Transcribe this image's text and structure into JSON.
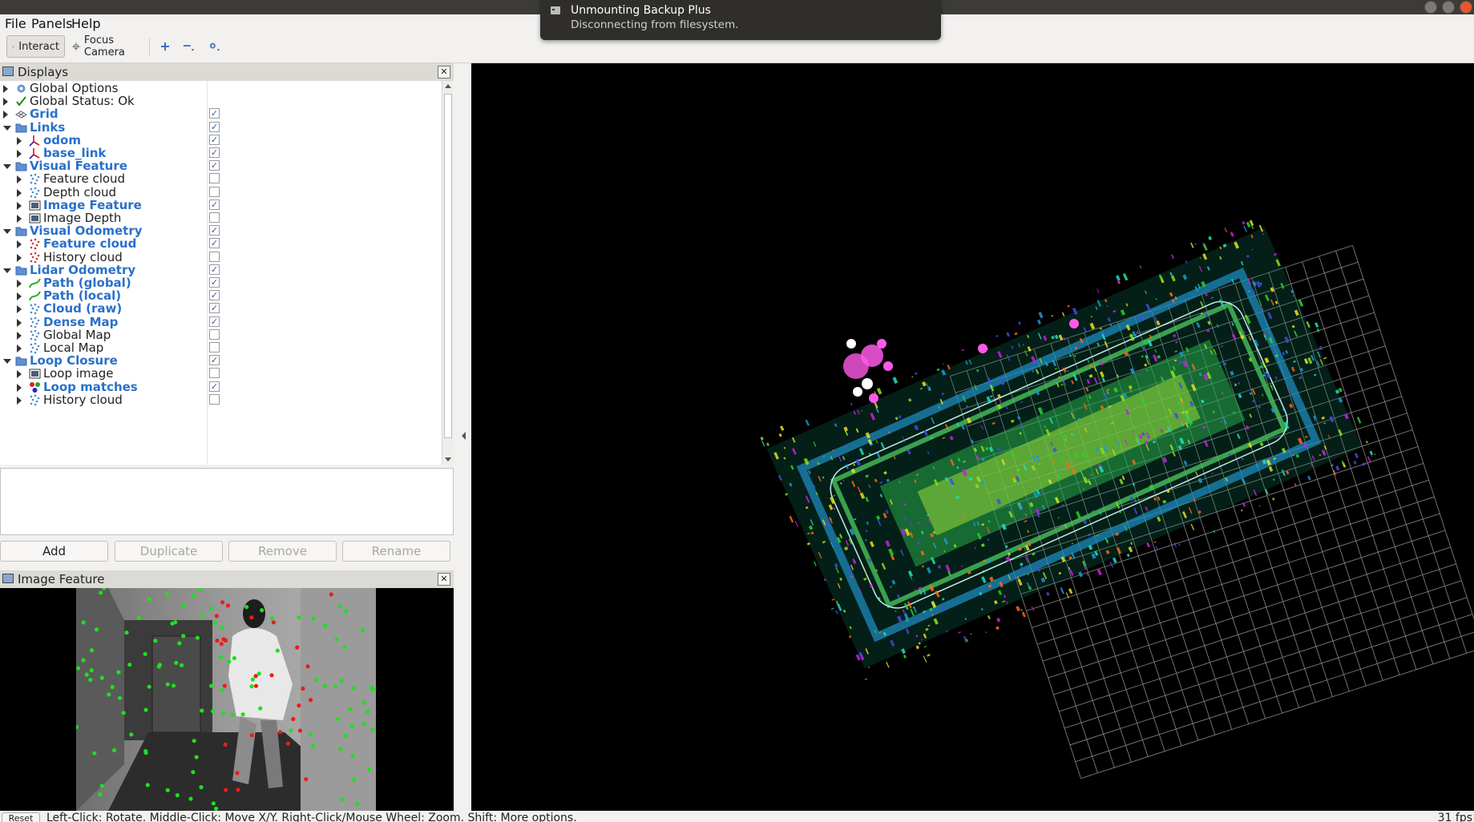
{
  "menu": {
    "file": "File",
    "panels": "Panels",
    "help": "Help"
  },
  "toolbar": {
    "interact": "Interact",
    "focus_camera": "Focus Camera"
  },
  "notification": {
    "title": "Unmounting Backup Plus",
    "message": "Disconnecting from filesystem."
  },
  "displays_panel": {
    "title": "Displays",
    "rows": [
      {
        "label": "Global Options",
        "indent": 0,
        "expand": "right",
        "icon": "gear-icon",
        "bold": false,
        "check": null
      },
      {
        "label": "Global Status: Ok",
        "indent": 0,
        "expand": "right",
        "icon": "checkmark-icon",
        "bold": false,
        "check": null
      },
      {
        "label": "Grid",
        "indent": 0,
        "expand": "right",
        "icon": "grid-icon",
        "bold": true,
        "check": true
      },
      {
        "label": "Links",
        "indent": 0,
        "expand": "down",
        "icon": "folder-icon",
        "bold": true,
        "check": true
      },
      {
        "label": "odom",
        "indent": 1,
        "expand": "right",
        "icon": "axes-icon",
        "bold": true,
        "check": true
      },
      {
        "label": "base_link",
        "indent": 1,
        "expand": "right",
        "icon": "axes-icon",
        "bold": true,
        "check": true
      },
      {
        "label": "Visual Feature",
        "indent": 0,
        "expand": "down",
        "icon": "folder-icon",
        "bold": true,
        "check": true
      },
      {
        "label": "Feature cloud",
        "indent": 1,
        "expand": "right",
        "icon": "pointcloud-icon",
        "bold": false,
        "check": false
      },
      {
        "label": "Depth cloud",
        "indent": 1,
        "expand": "right",
        "icon": "pointcloud-icon",
        "bold": false,
        "check": false
      },
      {
        "label": "Image Feature",
        "indent": 1,
        "expand": "right",
        "icon": "image-icon",
        "bold": true,
        "check": true
      },
      {
        "label": "Image Depth",
        "indent": 1,
        "expand": "right",
        "icon": "image-icon",
        "bold": false,
        "check": false
      },
      {
        "label": "Visual Odometry",
        "indent": 0,
        "expand": "down",
        "icon": "folder-icon",
        "bold": true,
        "check": true
      },
      {
        "label": "Feature cloud",
        "indent": 1,
        "expand": "right",
        "icon": "pointcloud-red-icon",
        "bold": true,
        "check": true
      },
      {
        "label": "History cloud",
        "indent": 1,
        "expand": "right",
        "icon": "pointcloud-red-icon",
        "bold": false,
        "check": false
      },
      {
        "label": "Lidar Odometry",
        "indent": 0,
        "expand": "down",
        "icon": "folder-icon",
        "bold": true,
        "check": true
      },
      {
        "label": "Path (global)",
        "indent": 1,
        "expand": "right",
        "icon": "path-icon",
        "bold": true,
        "check": true
      },
      {
        "label": "Path (local)",
        "indent": 1,
        "expand": "right",
        "icon": "path-icon",
        "bold": true,
        "check": true
      },
      {
        "label": "Cloud (raw)",
        "indent": 1,
        "expand": "right",
        "icon": "pointcloud-icon",
        "bold": true,
        "check": true
      },
      {
        "label": "Dense Map",
        "indent": 1,
        "expand": "right",
        "icon": "pointcloud-icon",
        "bold": true,
        "check": true
      },
      {
        "label": "Global Map",
        "indent": 1,
        "expand": "right",
        "icon": "pointcloud-icon",
        "bold": false,
        "check": false
      },
      {
        "label": "Local Map",
        "indent": 1,
        "expand": "right",
        "icon": "pointcloud-icon",
        "bold": false,
        "check": false
      },
      {
        "label": "Loop Closure",
        "indent": 0,
        "expand": "down",
        "icon": "folder-icon",
        "bold": true,
        "check": true
      },
      {
        "label": "Loop image",
        "indent": 1,
        "expand": "right",
        "icon": "image-icon",
        "bold": false,
        "check": false
      },
      {
        "label": "Loop matches",
        "indent": 1,
        "expand": "right",
        "icon": "markers-icon",
        "bold": true,
        "check": true
      },
      {
        "label": "History cloud",
        "indent": 1,
        "expand": "right",
        "icon": "pointcloud-icon",
        "bold": false,
        "check": false
      }
    ],
    "buttons": {
      "add": "Add",
      "duplicate": "Duplicate",
      "remove": "Remove",
      "rename": "Rename"
    }
  },
  "image_panel": {
    "title": "Image Feature"
  },
  "statusbar": {
    "reset": "Reset",
    "help": "Left-Click: Rotate. Middle-Click: Move X/Y. Right-Click/Mouse Wheel: Zoom. Shift: More options.",
    "fps": "31 fps"
  },
  "colors": {
    "accent_blue": "#2a70c9",
    "panel_header": "#dcdad5",
    "title_bar": "#3c3b37"
  }
}
